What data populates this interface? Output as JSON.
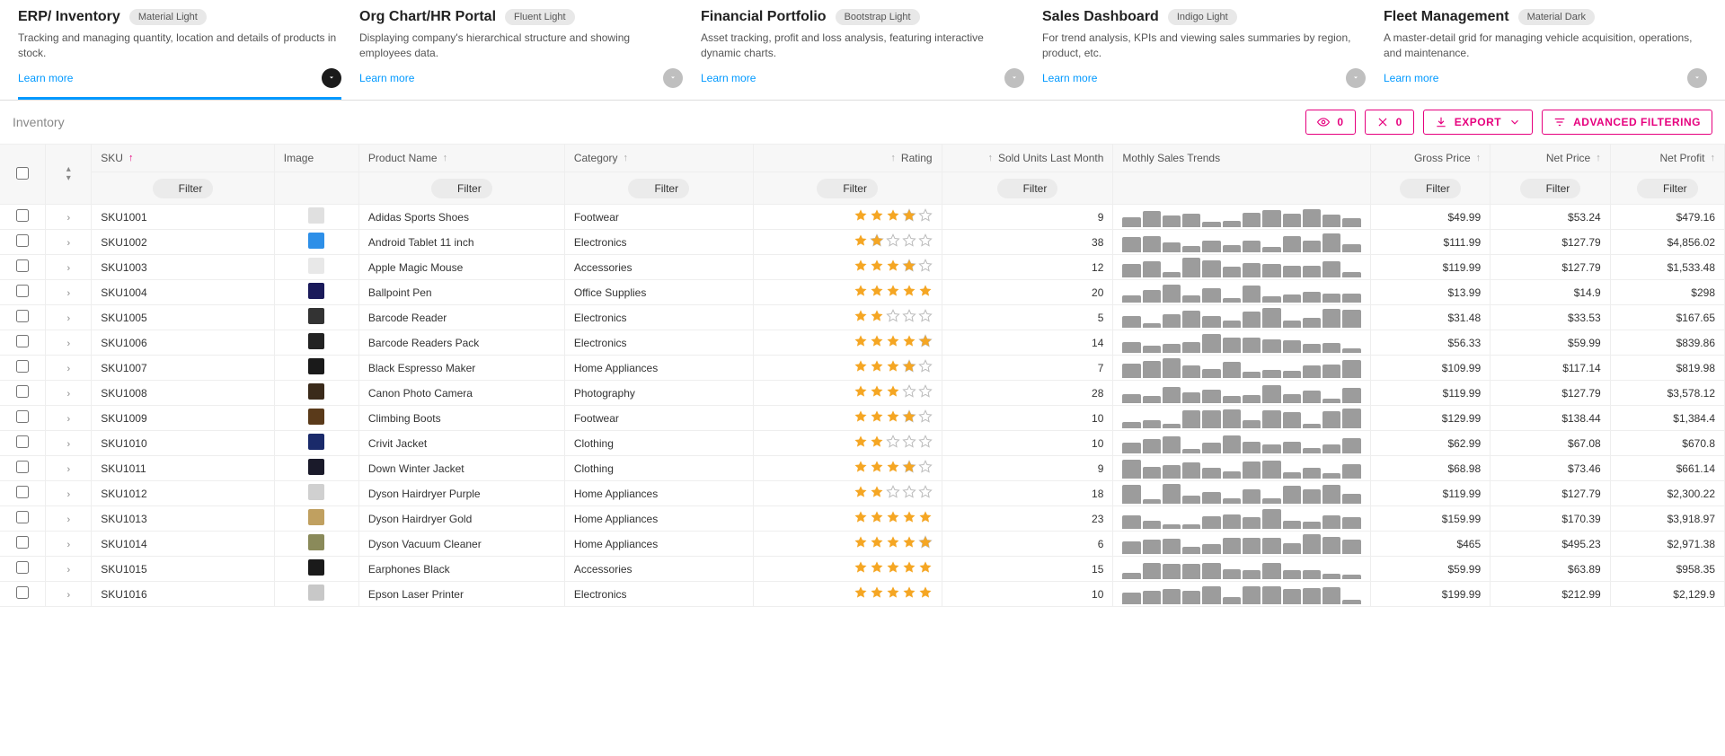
{
  "tabs": [
    {
      "title": "ERP/ Inventory",
      "theme": "Material Light",
      "desc": "Tracking and managing quantity, location and details of products in stock.",
      "active": true
    },
    {
      "title": "Org Chart/HR Portal",
      "theme": "Fluent Light",
      "desc": "Displaying company's hierarchical structure and showing employees data.",
      "active": false
    },
    {
      "title": "Financial Portfolio",
      "theme": "Bootstrap Light",
      "desc": "Asset tracking, profit and loss analysis, featuring interactive dynamic charts.",
      "active": false
    },
    {
      "title": "Sales Dashboard",
      "theme": "Indigo Light",
      "desc": "For trend analysis, KPIs and viewing sales summaries by region, product, etc.",
      "active": false
    },
    {
      "title": "Fleet Management",
      "theme": "Material Dark",
      "desc": "A master-detail grid for managing vehicle acquisition, operations, and maintenance.",
      "active": false
    }
  ],
  "learn_more": "Learn more",
  "toolbar": {
    "title": "Inventory",
    "hidden_count": "0",
    "pinned_count": "0",
    "export_label": "EXPORT",
    "advanced_label": "ADVANCED FILTERING"
  },
  "columns": {
    "sku": "SKU",
    "image": "Image",
    "product": "Product Name",
    "category": "Category",
    "rating": "Rating",
    "sold": "Sold Units Last Month",
    "trend": "Mothly Sales Trends",
    "gross": "Gross Price",
    "net": "Net Price",
    "profit": "Net Profit",
    "filter": "Filter"
  },
  "rows": [
    {
      "sku": "SKU1001",
      "img": "#e0e0e0",
      "name": "Adidas Sports Shoes",
      "cat": "Footwear",
      "rating": 3.5,
      "sold": "9",
      "gross": "$49.99",
      "net": "$53.24",
      "profit": "$479.16"
    },
    {
      "sku": "SKU1002",
      "img": "#2d8fe8",
      "name": "Android Tablet 11 inch",
      "cat": "Electronics",
      "rating": 1.5,
      "sold": "38",
      "gross": "$111.99",
      "net": "$127.79",
      "profit": "$4,856.02"
    },
    {
      "sku": "SKU1003",
      "img": "#e8e8e8",
      "name": "Apple Magic Mouse",
      "cat": "Accessories",
      "rating": 3.5,
      "sold": "12",
      "gross": "$119.99",
      "net": "$127.79",
      "profit": "$1,533.48"
    },
    {
      "sku": "SKU1004",
      "img": "#1a1a5a",
      "name": "Ballpoint Pen",
      "cat": "Office Supplies",
      "rating": 5,
      "sold": "20",
      "gross": "$13.99",
      "net": "$14.9",
      "profit": "$298"
    },
    {
      "sku": "SKU1005",
      "img": "#333333",
      "name": "Barcode Reader",
      "cat": "Electronics",
      "rating": 2,
      "sold": "5",
      "gross": "$31.48",
      "net": "$33.53",
      "profit": "$167.65"
    },
    {
      "sku": "SKU1006",
      "img": "#222222",
      "name": "Barcode Readers Pack",
      "cat": "Electronics",
      "rating": 4.5,
      "sold": "14",
      "gross": "$56.33",
      "net": "$59.99",
      "profit": "$839.86"
    },
    {
      "sku": "SKU1007",
      "img": "#1a1a1a",
      "name": "Black Espresso Maker",
      "cat": "Home Appliances",
      "rating": 3.5,
      "sold": "7",
      "gross": "$109.99",
      "net": "$117.14",
      "profit": "$819.98"
    },
    {
      "sku": "SKU1008",
      "img": "#3a2a1a",
      "name": "Canon Photo Camera",
      "cat": "Photography",
      "rating": 3,
      "sold": "28",
      "gross": "$119.99",
      "net": "$127.79",
      "profit": "$3,578.12"
    },
    {
      "sku": "SKU1009",
      "img": "#5a3a1a",
      "name": "Climbing Boots",
      "cat": "Footwear",
      "rating": 3.5,
      "sold": "10",
      "gross": "$129.99",
      "net": "$138.44",
      "profit": "$1,384.4"
    },
    {
      "sku": "SKU1010",
      "img": "#1a2a6a",
      "name": "Crivit Jacket",
      "cat": "Clothing",
      "rating": 2,
      "sold": "10",
      "gross": "$62.99",
      "net": "$67.08",
      "profit": "$670.8"
    },
    {
      "sku": "SKU1011",
      "img": "#1a1a2a",
      "name": "Down Winter Jacket",
      "cat": "Clothing",
      "rating": 3.5,
      "sold": "9",
      "gross": "$68.98",
      "net": "$73.46",
      "profit": "$661.14"
    },
    {
      "sku": "SKU1012",
      "img": "#d0d0d0",
      "name": "Dyson Hairdryer Purple",
      "cat": "Home Appliances",
      "rating": 2,
      "sold": "18",
      "gross": "$119.99",
      "net": "$127.79",
      "profit": "$2,300.22"
    },
    {
      "sku": "SKU1013",
      "img": "#c0a060",
      "name": "Dyson Hairdryer Gold",
      "cat": "Home Appliances",
      "rating": 5,
      "sold": "23",
      "gross": "$159.99",
      "net": "$170.39",
      "profit": "$3,918.97"
    },
    {
      "sku": "SKU1014",
      "img": "#8a8a5a",
      "name": "Dyson Vacuum Cleaner",
      "cat": "Home Appliances",
      "rating": 4.5,
      "sold": "6",
      "gross": "$465",
      "net": "$495.23",
      "profit": "$2,971.38"
    },
    {
      "sku": "SKU1015",
      "img": "#1a1a1a",
      "name": "Earphones Black",
      "cat": "Accessories",
      "rating": 5,
      "sold": "15",
      "gross": "$59.99",
      "net": "$63.89",
      "profit": "$958.35"
    },
    {
      "sku": "SKU1016",
      "img": "#c8c8c8",
      "name": "Epson Laser Printer",
      "cat": "Electronics",
      "rating": 5,
      "sold": "10",
      "gross": "$199.99",
      "net": "$212.99",
      "profit": "$2,129.9"
    }
  ]
}
